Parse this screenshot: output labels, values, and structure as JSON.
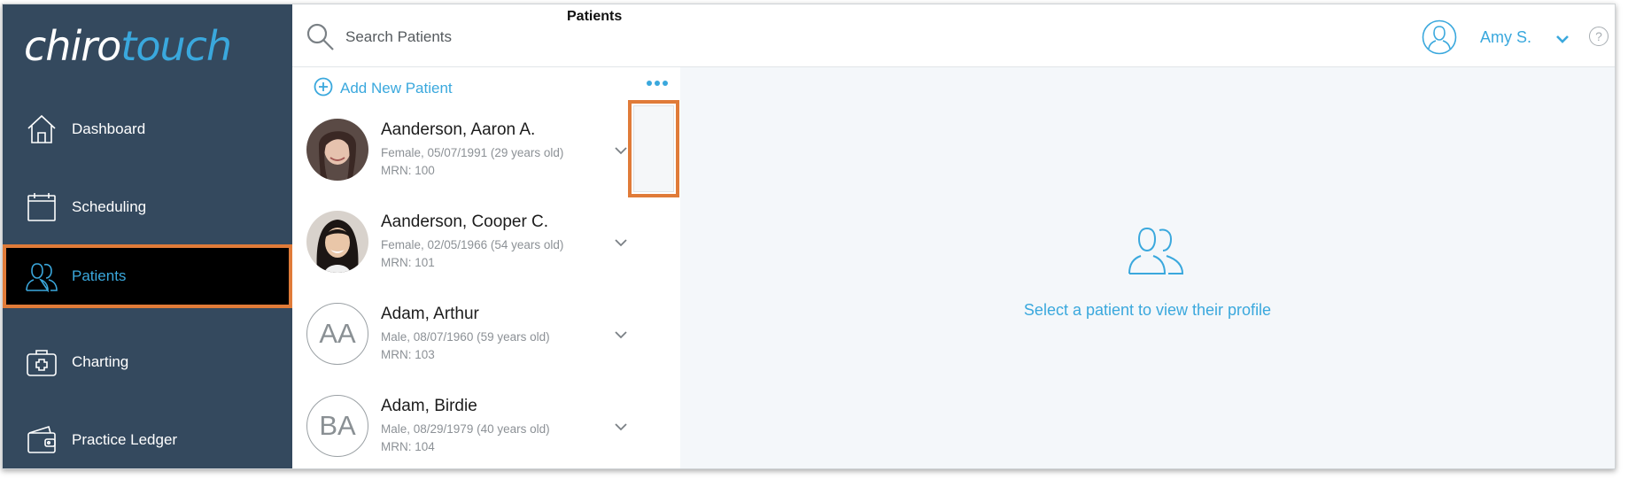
{
  "app": {
    "logo_part1": "chiro",
    "logo_part2": "touch"
  },
  "sidebar": {
    "items": [
      {
        "label": "Dashboard",
        "icon": "home-icon",
        "active": false
      },
      {
        "label": "Scheduling",
        "icon": "calendar-icon",
        "active": false
      },
      {
        "label": "Patients",
        "icon": "patients-icon",
        "active": true
      },
      {
        "label": "Charting",
        "icon": "medical-kit-icon",
        "active": false
      },
      {
        "label": "Practice Ledger",
        "icon": "wallet-icon",
        "active": false
      }
    ]
  },
  "search": {
    "placeholder": "Search Patients",
    "value": ""
  },
  "list": {
    "title": "Patients",
    "add_label": "Add New Patient",
    "patients": [
      {
        "name": "Aanderson, Aaron A.",
        "info": "Female, 05/07/1991 (29 years old)",
        "mrn": "MRN: 100",
        "avatar": "photo"
      },
      {
        "name": "Aanderson, Cooper C.",
        "info": "Female, 02/05/1966 (54 years old)",
        "mrn": "MRN: 101",
        "avatar": "photo"
      },
      {
        "name": "Adam, Arthur",
        "info": "Male, 08/07/1960 (59 years old)",
        "mrn": "MRN: 103",
        "initials": "AA"
      },
      {
        "name": "Adam, Birdie",
        "info": "Male, 08/29/1979 (40 years old)",
        "mrn": "MRN: 104",
        "initials": "BA"
      }
    ]
  },
  "header": {
    "user_name": "Amy S.",
    "help_symbol": "?"
  },
  "main": {
    "empty_message": "Select a patient to view their profile"
  },
  "colors": {
    "sidebar_bg": "#34495e",
    "accent": "#3aa8dd",
    "highlight": "#e07b39",
    "content_bg": "#f4f7fa"
  }
}
